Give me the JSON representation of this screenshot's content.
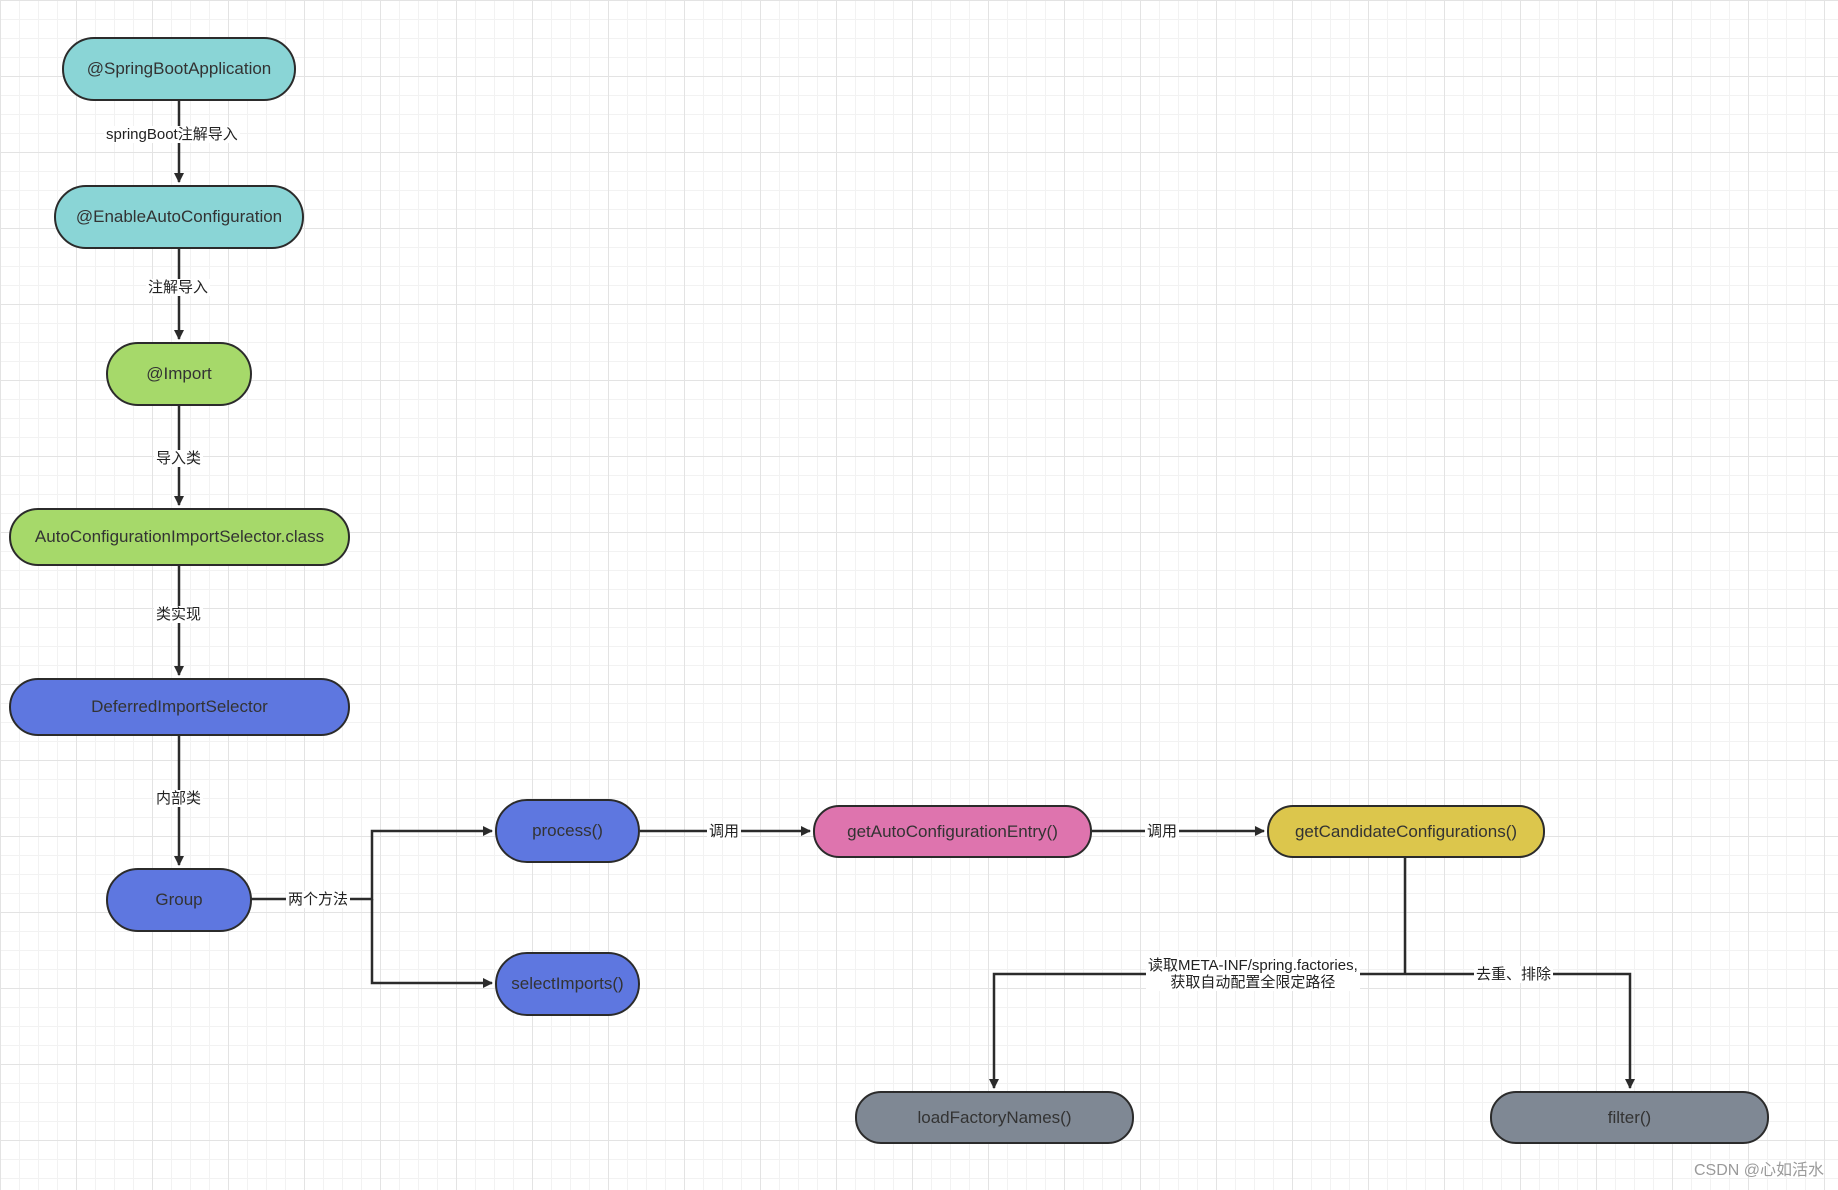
{
  "diagram": {
    "nodes": [
      {
        "id": "springbootapp",
        "label": "@SpringBootApplication",
        "color": "#8ad5d6"
      },
      {
        "id": "enableauto",
        "label": "@EnableAutoConfiguration",
        "color": "#8ad5d6"
      },
      {
        "id": "import",
        "label": "@Import",
        "color": "#a6d96a"
      },
      {
        "id": "selectorclass",
        "label": "AutoConfigurationImportSelector.class",
        "color": "#a6d96a"
      },
      {
        "id": "deferred",
        "label": "DeferredImportSelector",
        "color": "#5e77e0"
      },
      {
        "id": "group",
        "label": "Group",
        "color": "#5e77e0"
      },
      {
        "id": "process",
        "label": "process()",
        "color": "#5e77e0"
      },
      {
        "id": "selectimports",
        "label": "selectImports()",
        "color": "#5e77e0"
      },
      {
        "id": "getautoentry",
        "label": "getAutoConfigurationEntry()",
        "color": "#de74ae"
      },
      {
        "id": "getcandidates",
        "label": "getCandidateConfigurations()",
        "color": "#dcc64c"
      },
      {
        "id": "loadfactory",
        "label": "loadFactoryNames()",
        "color": "#7f8894"
      },
      {
        "id": "filter",
        "label": "filter()",
        "color": "#7f8894"
      }
    ],
    "edges": [
      {
        "id": "e1",
        "label": "springBoot注解导入"
      },
      {
        "id": "e2",
        "label": "注解导入"
      },
      {
        "id": "e3",
        "label": "导入类"
      },
      {
        "id": "e4",
        "label": "类实现"
      },
      {
        "id": "e5",
        "label": "内部类"
      },
      {
        "id": "e6",
        "label": "两个方法"
      },
      {
        "id": "e7",
        "label": "调用"
      },
      {
        "id": "e8",
        "label": "调用"
      },
      {
        "id": "e9",
        "label": "读取META-INF/spring.factories,\n获取自动配置全限定路径"
      },
      {
        "id": "e10",
        "label": "去重、排除"
      }
    ]
  },
  "watermark": "CSDN @心如活水"
}
